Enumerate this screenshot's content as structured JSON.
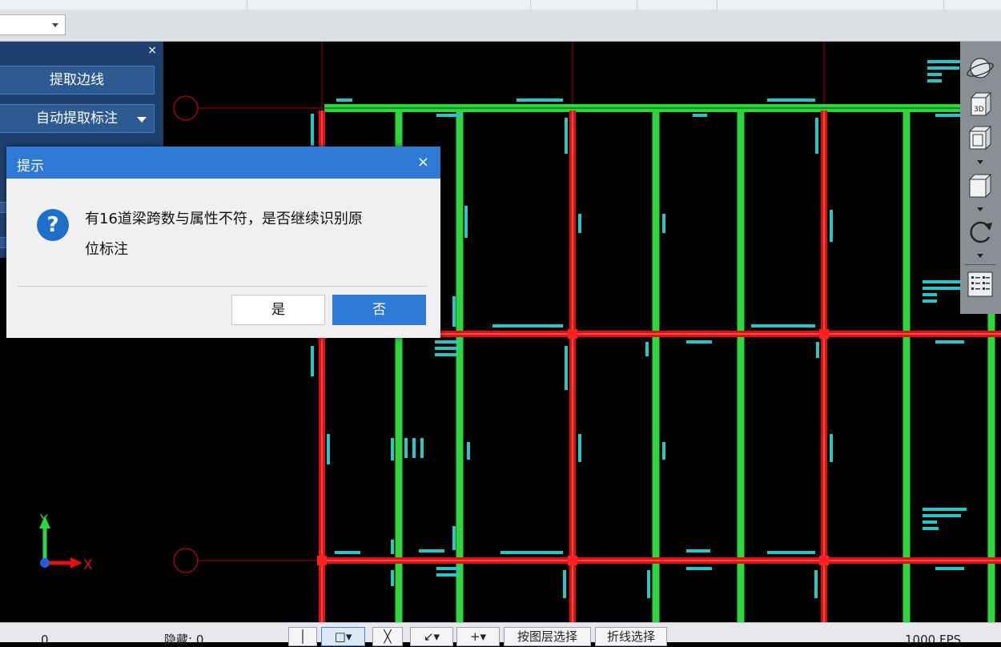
{
  "side_panel": {
    "close_label": "×",
    "btn_extract_edge": "提取边线",
    "btn_auto_extract": "自动提取标注"
  },
  "dialog": {
    "title": "提示",
    "close_label": "×",
    "icon_glyph": "?",
    "message_line1": "有16道梁跨数与属性不符，是否继续识别原",
    "message_line2": "位标注",
    "yes_label": "是",
    "no_label": "否"
  },
  "axis": {
    "y_label": "Y",
    "x_label": "X"
  },
  "statusbar": {
    "count_value": "0",
    "hidden_text": "隐藏: 0",
    "layer_select_label": "按图层选择",
    "polyline_select_label": "折线选择",
    "fps_text": "1000 FPS"
  },
  "viewbar": {
    "cube_3d_label": "3D"
  },
  "colors": {
    "accent": "#2e7ad5",
    "panel": "#1f3f6e",
    "beam_green": "#2cd63c",
    "beam_red": "#e01010",
    "annotation": "#27c7c7"
  }
}
